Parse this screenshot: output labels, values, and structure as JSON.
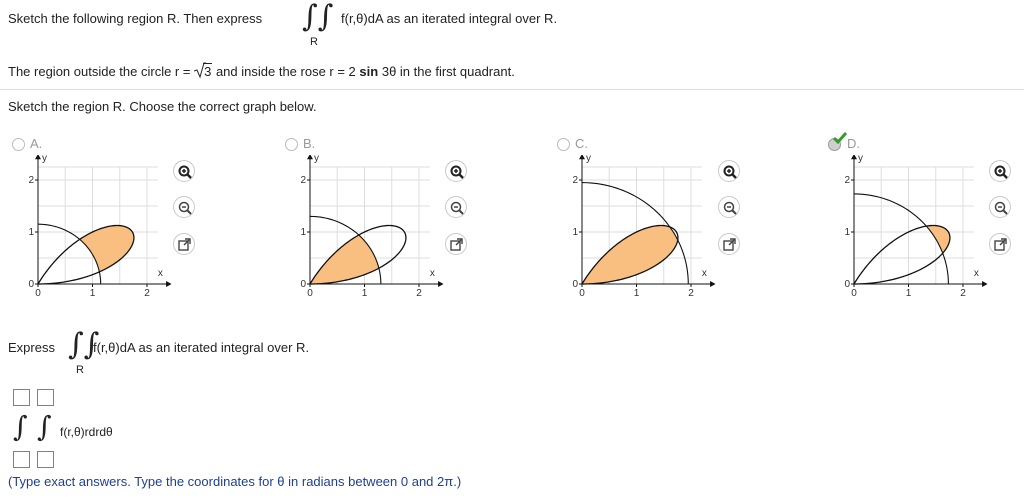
{
  "prompt": {
    "line1_before": "Sketch the following region R. Then express",
    "line1_after": "f(r,θ)dA as an iterated integral over R.",
    "region_label": "R",
    "line2_before": "The region outside the circle r =",
    "sqrt_value": "3",
    "line2_middle": "and inside the rose r = 2",
    "line2_sin": "sin",
    "line2_after": "3θ in the first quadrant.",
    "instruction": "Sketch the region R. Choose the correct graph below."
  },
  "options": [
    {
      "letter": "A.",
      "selected": false
    },
    {
      "letter": "B.",
      "selected": false
    },
    {
      "letter": "C.",
      "selected": false
    },
    {
      "letter": "D.",
      "selected": true
    }
  ],
  "graph": {
    "y_axis_label": "y",
    "x_axis_label": "x",
    "y_ticks": [
      "2",
      "1",
      "0"
    ],
    "x_ticks": [
      "0",
      "1",
      "2"
    ],
    "fill_color": "#f9bf80"
  },
  "icons": {
    "zoom_in": "zoom-in-icon",
    "zoom_out": "zoom-out-icon",
    "popout": "popout-icon",
    "check": "checkmark-icon"
  },
  "express": {
    "label": "Express",
    "integrand": "f(r,θ)dA as an iterated integral over R.",
    "region_label": "R",
    "answer_integrand": "f(r,θ)rdrdθ",
    "note": "(Type exact answers. Type the coordinates for θ in radians between 0 and 2π.)"
  }
}
